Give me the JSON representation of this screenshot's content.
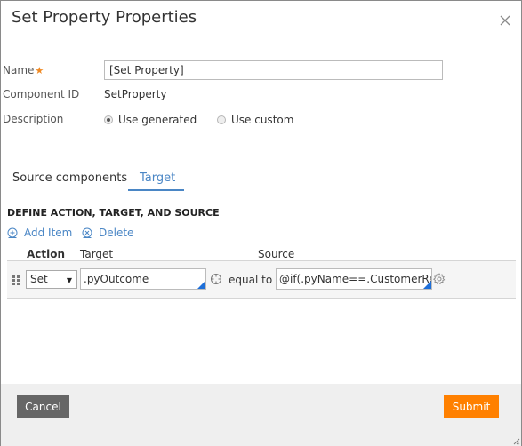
{
  "dialog": {
    "title": "Set Property Properties",
    "close_icon": "close-x-icon"
  },
  "form": {
    "name_label": "Name",
    "required_marker": "★",
    "name_value": "[Set Property]",
    "component_id_label": "Component ID",
    "component_id_value": "SetProperty",
    "description_label": "Description",
    "description_options": [
      {
        "label": "Use generated",
        "selected": true
      },
      {
        "label": "Use custom",
        "selected": false
      }
    ]
  },
  "tabs": [
    {
      "label": "Source components",
      "active": false
    },
    {
      "label": "Target",
      "active": true
    }
  ],
  "section": {
    "title": "DEFINE ACTION, TARGET, AND SOURCE",
    "add_item_label": "Add Item",
    "delete_label": "Delete"
  },
  "table": {
    "headers": {
      "action": "Action",
      "target": "Target",
      "source": "Source"
    },
    "rows": [
      {
        "action": "Set",
        "target": ".pyOutcome",
        "operator": "equal to",
        "source": "@if(.pyName==.CustomerResponse"
      }
    ]
  },
  "footer": {
    "cancel_label": "Cancel",
    "submit_label": "Submit"
  },
  "colors": {
    "accent_blue": "#4a86c5",
    "submit_orange": "#ff8000",
    "cancel_gray": "#666666",
    "required_orange": "#f08a24"
  }
}
